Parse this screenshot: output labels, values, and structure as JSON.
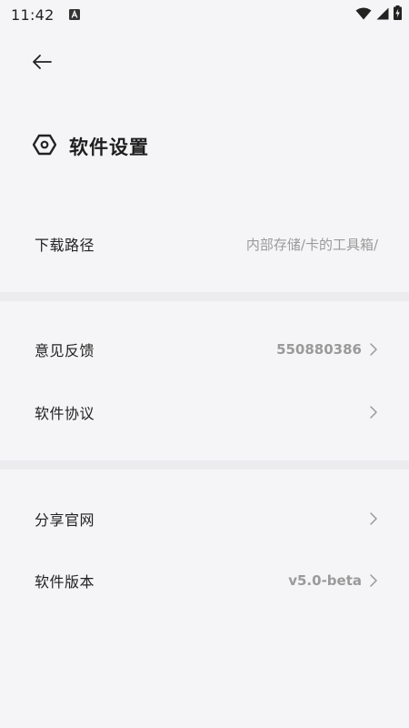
{
  "status_bar": {
    "time": "11:42",
    "notification_icon": "text-notification-icon",
    "icons": [
      "wifi-icon",
      "signal-icon",
      "battery-charging-icon"
    ]
  },
  "header": {
    "back_icon": "arrow-left-icon",
    "title_icon": "hexagon-settings-icon",
    "title": "软件设置"
  },
  "sections": [
    {
      "items": [
        {
          "label": "下载路径",
          "value": "内部存储/卡的工具箱/",
          "chevron": false
        }
      ]
    },
    {
      "items": [
        {
          "label": "意见反馈",
          "value": "550880386",
          "chevron": true
        },
        {
          "label": "软件协议",
          "value": "",
          "chevron": true
        }
      ]
    },
    {
      "items": [
        {
          "label": "分享官网",
          "value": "",
          "chevron": true
        },
        {
          "label": "软件版本",
          "value": "v5.0-beta",
          "chevron": true
        }
      ]
    }
  ],
  "colors": {
    "background": "#f5f5f7",
    "divider": "#ececef",
    "text_primary": "#222222",
    "text_secondary": "#9a9a9a"
  }
}
